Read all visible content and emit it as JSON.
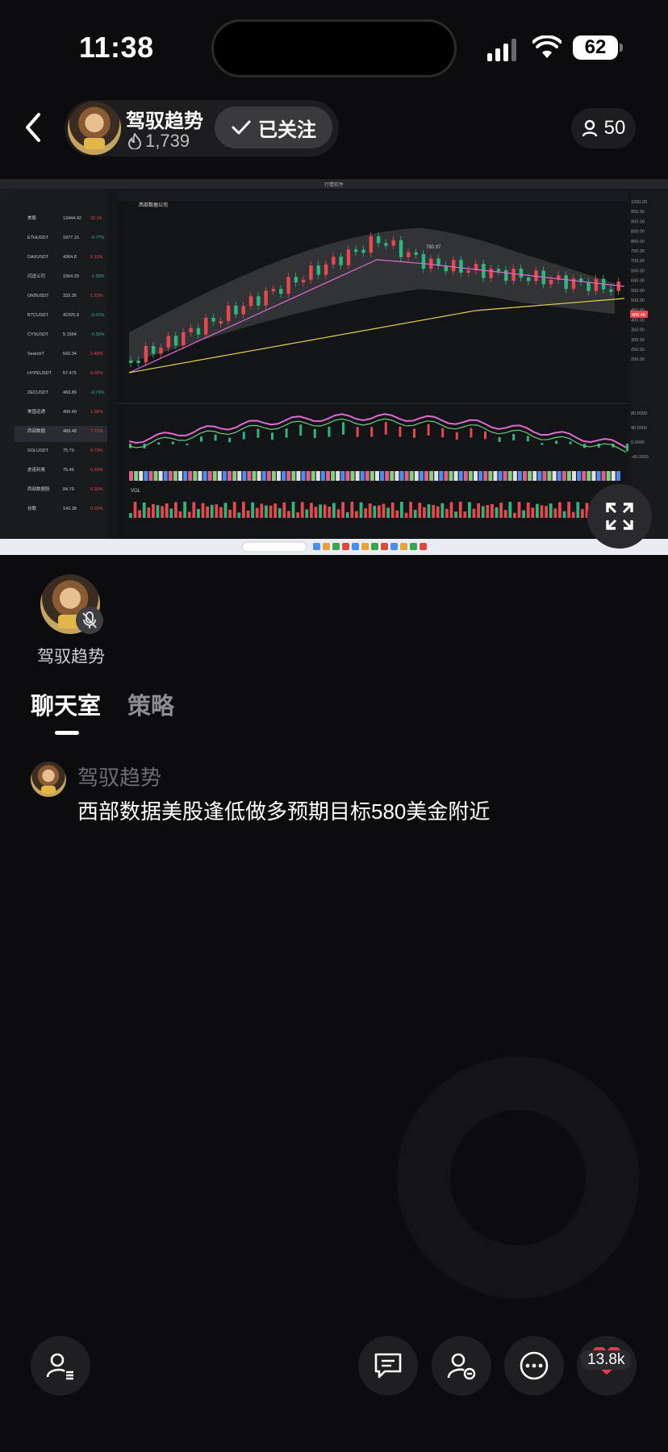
{
  "status_bar": {
    "time": "11:38",
    "battery": "62"
  },
  "host": {
    "name": "驾驭趋势",
    "likes": "1,739",
    "follow_label": "已关注"
  },
  "viewers": {
    "count": "50"
  },
  "screen_share": {
    "window_title": "行情软件",
    "symbol": "西部数据公司",
    "watchlist": [
      {
        "name": "美股",
        "price": "13444.42",
        "change": "32.19"
      },
      {
        "name": "ETHUSDT",
        "price": "1877.15",
        "change": "-0.77%"
      },
      {
        "name": "DAXUSDT",
        "price": "4364.8",
        "change": "0.11%"
      },
      {
        "name": "闪送公司",
        "price": "1564.29",
        "change": "-1.39%"
      },
      {
        "name": "OKBUSDT",
        "price": "332.35",
        "change": "1.33%"
      },
      {
        "name": "BTCUSDT",
        "price": "42325.9",
        "change": "-0.41%"
      },
      {
        "name": "CYSUSDT",
        "price": "5.1564",
        "change": "-0.39%"
      },
      {
        "name": "SearchT",
        "price": "542.34",
        "change": "2.48%"
      },
      {
        "name": "HYPEUSDT",
        "price": "57.475",
        "change": "6.68%"
      },
      {
        "name": "ZECUSDT",
        "price": "483.89",
        "change": "-0.73%"
      },
      {
        "name": "美国运通",
        "price": "490.40",
        "change": "1.98%"
      },
      {
        "name": "西部数据",
        "price": "489.48",
        "change": "7.72%"
      },
      {
        "name": "SOLUSDT",
        "price": "75.70",
        "change": "0.73%"
      },
      {
        "name": "皮诺利奥",
        "price": "75.46",
        "change": "0.55%"
      },
      {
        "name": "西部数据股",
        "price": "84.79",
        "change": "0.30%"
      },
      {
        "name": "谷歌",
        "price": "142.38",
        "change": "0.39%"
      }
    ],
    "price_axis": [
      "1000.00",
      "950.00",
      "900.00",
      "850.00",
      "800.00",
      "750.00",
      "700.00",
      "650.00",
      "600.00",
      "550.00",
      "500.00",
      "450.00",
      "400.00",
      "350.00",
      "300.00",
      "250.00",
      "200.00"
    ],
    "current_price": "489.48",
    "peak_label": "780.97",
    "macd_axis": [
      "80.0000",
      "40.0000",
      "0.0000",
      "-40.0000"
    ],
    "vol_label": "VOL"
  },
  "guest": {
    "name": "驾驭趋势"
  },
  "tabs": [
    {
      "label": "聊天室"
    },
    {
      "label": "策略"
    }
  ],
  "messages": [
    {
      "user": "驾驭趋势",
      "text": "西部数据美股逢低做多预期目标580美金附近"
    }
  ],
  "bottom": {
    "likes": "13.8k"
  },
  "colors": {
    "accent_heart": "#f0334f",
    "bg": "#0c0c0e",
    "up": "#e5484d",
    "down": "#2fb67c"
  },
  "icons": [
    "back-icon",
    "flame-icon",
    "check-icon",
    "person-icon",
    "expand-icon",
    "mic-off-icon",
    "guest-list-icon",
    "chat-icon",
    "user-remove-icon",
    "more-icon",
    "heart-icon"
  ]
}
